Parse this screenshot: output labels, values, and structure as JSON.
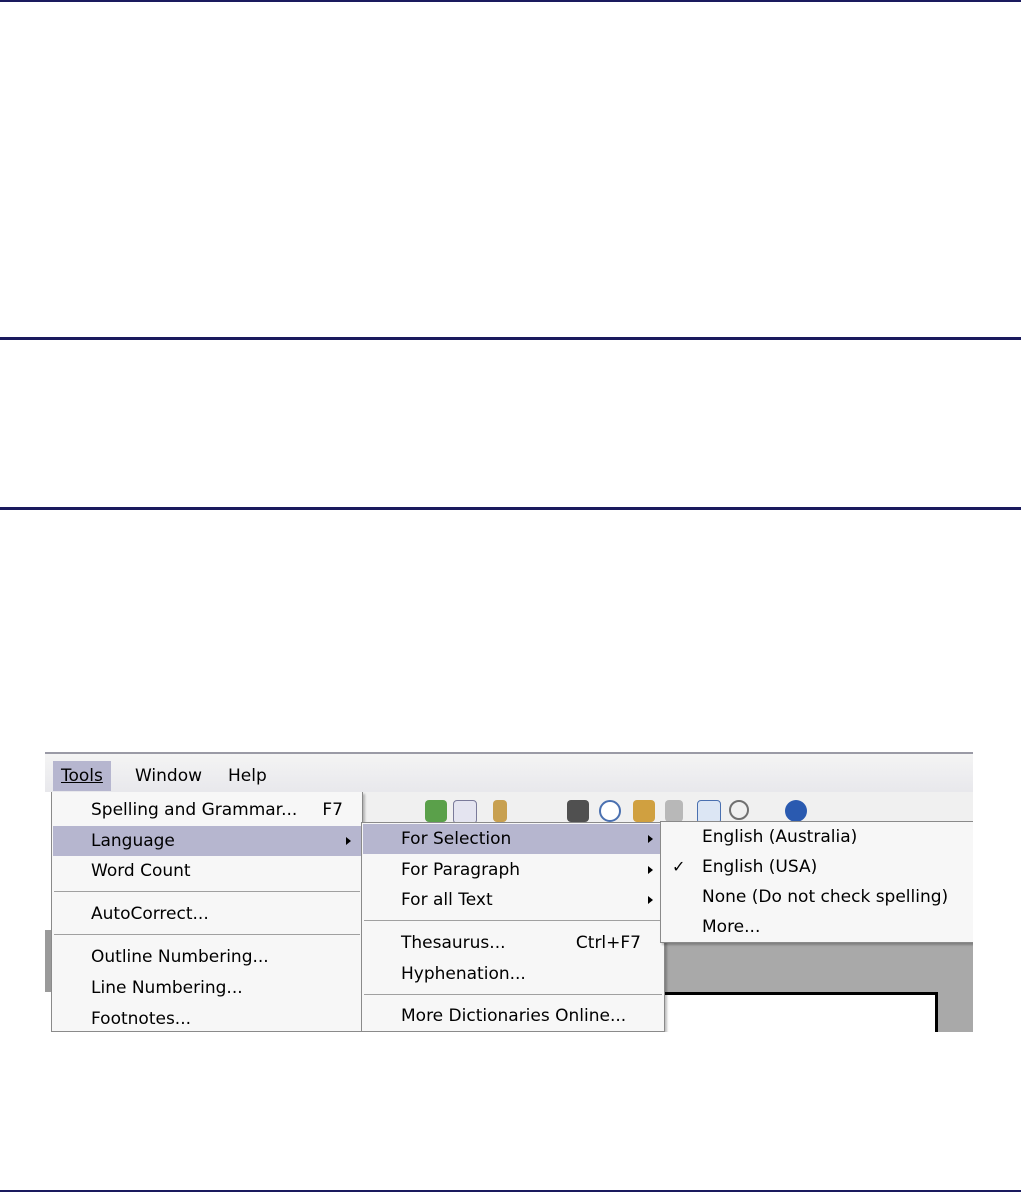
{
  "menubar": {
    "tools": "Tools",
    "window": "Window",
    "help": "Help"
  },
  "tools_menu": {
    "spelling": "Spelling and Grammar...",
    "spelling_shortcut": "F7",
    "language": "Language",
    "word_count": "Word Count",
    "autocorrect": "AutoCorrect...",
    "outline_numbering": "Outline Numbering...",
    "line_numbering": "Line Numbering...",
    "footnotes": "Footnotes..."
  },
  "language_menu": {
    "for_selection": "For Selection",
    "for_paragraph": "For Paragraph",
    "for_all_text": "For all Text",
    "thesaurus": "Thesaurus...",
    "thesaurus_shortcut": "Ctrl+F7",
    "hyphenation": "Hyphenation...",
    "more_dictionaries": "More Dictionaries Online..."
  },
  "selection_menu": {
    "english_australia": "English (Australia)",
    "english_usa": "English (USA)",
    "none": "None (Do not check spelling)",
    "more": "More...",
    "checked_item": "English (USA)"
  },
  "colors": {
    "highlight": "#b6b6cf",
    "rule": "#1a1a5e"
  }
}
